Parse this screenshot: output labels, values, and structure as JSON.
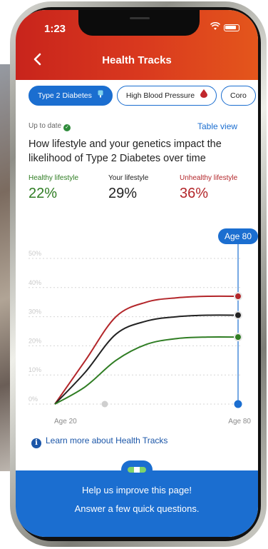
{
  "status": {
    "time": "1:23"
  },
  "header": {
    "title": "Health Tracks",
    "back_icon": "chevron-left-icon"
  },
  "chips": [
    {
      "label": "Type 2 Diabetes",
      "icon": "glucose-meter-icon",
      "active": true
    },
    {
      "label": "High Blood Pressure",
      "icon": "blood-drop-icon",
      "active": false
    },
    {
      "label": "Coro",
      "active": false
    }
  ],
  "status_line": {
    "uptodate": "Up to date",
    "table_view": "Table view"
  },
  "heading": "How lifestyle and your genetics impact the likelihood of Type 2 Diabetes over time",
  "stats": {
    "healthy": {
      "label": "Healthy lifestyle",
      "value": "22%"
    },
    "yours": {
      "label": "Your lifestyle",
      "value": "29%"
    },
    "unhealthy": {
      "label": "Unhealthy lifestyle",
      "value": "36%"
    }
  },
  "colors": {
    "accent": "#1b6ed0",
    "healthy": "#2f7d23",
    "yours": "#222222",
    "unhealthy": "#b3262a",
    "header": "#d9381e"
  },
  "chart_data": {
    "type": "line",
    "x": [
      20,
      30,
      40,
      50,
      60,
      70,
      80
    ],
    "xlabel_left": "Age 20",
    "xlabel_right": "Age 80",
    "marker_label": "Age 80",
    "yticks": [
      "0%",
      "10%",
      "20%",
      "30%",
      "40%",
      "50%"
    ],
    "ylim": [
      0,
      50
    ],
    "series": [
      {
        "name": "Unhealthy lifestyle",
        "color": "#b3262a",
        "values": [
          0,
          15,
          30,
          35,
          36.5,
          37,
          37
        ]
      },
      {
        "name": "Your lifestyle",
        "color": "#222222",
        "values": [
          0,
          11,
          24,
          28.5,
          30,
          30.5,
          30.5
        ]
      },
      {
        "name": "Healthy lifestyle",
        "color": "#2f7d23",
        "values": [
          0,
          6,
          15,
          20.5,
          22.5,
          23,
          23
        ]
      }
    ]
  },
  "learn_more": "Learn more about Health Tracks",
  "feedback": {
    "line1": "Help us improve this page!",
    "line2": "Answer a few quick questions."
  }
}
